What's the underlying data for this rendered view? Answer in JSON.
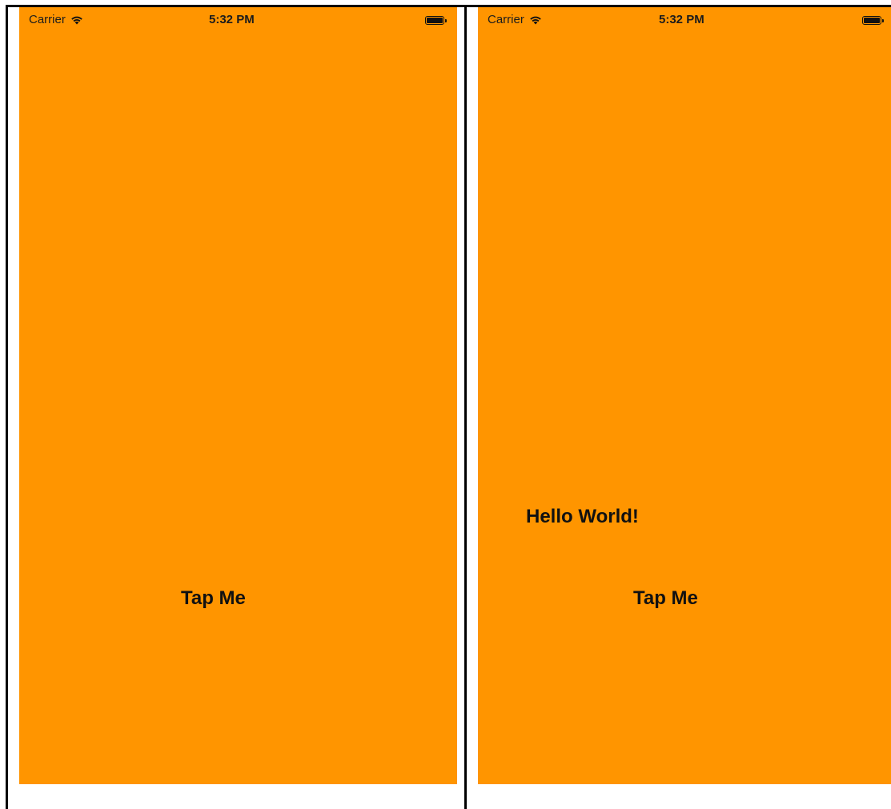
{
  "colors": {
    "screen_background": "#ff9500",
    "text": "#111111"
  },
  "screens": [
    {
      "status_bar": {
        "carrier": "Carrier",
        "time": "5:32 PM",
        "wifi_icon": "wifi-icon",
        "battery_icon": "battery-icon"
      },
      "button_label": "Tap Me"
    },
    {
      "status_bar": {
        "carrier": "Carrier",
        "time": "5:32 PM",
        "wifi_icon": "wifi-icon",
        "battery_icon": "battery-icon"
      },
      "label_text": "Hello World!",
      "button_label": "Tap Me"
    }
  ]
}
